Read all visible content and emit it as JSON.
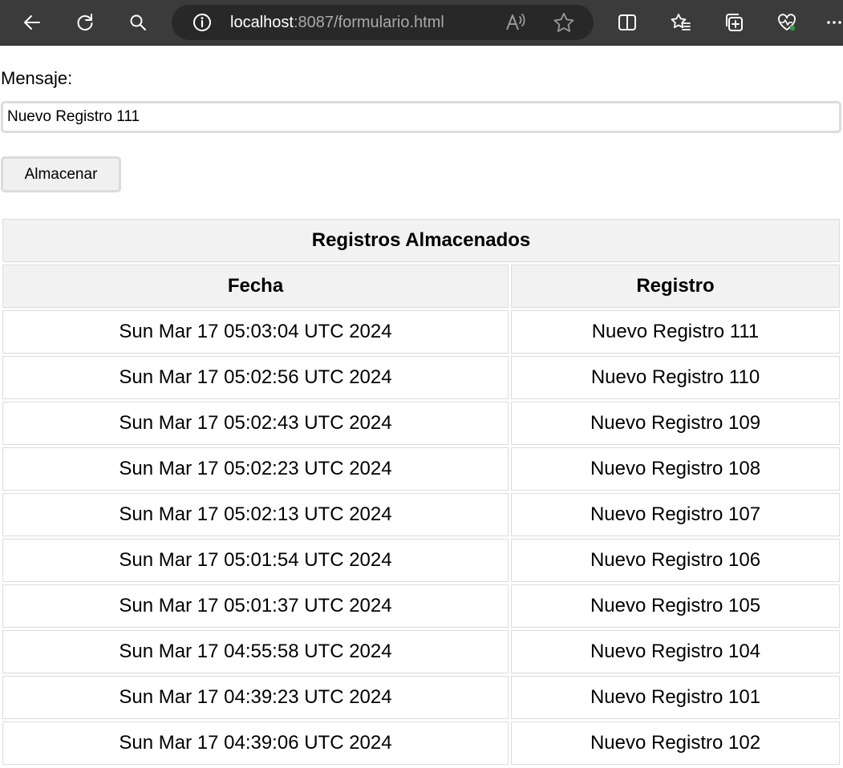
{
  "browser": {
    "url_host": "localhost",
    "url_rest": ":8087/formulario.html"
  },
  "form": {
    "label": "Mensaje:",
    "input_value": "Nuevo Registro 111",
    "submit_label": "Almacenar"
  },
  "table": {
    "caption": "Registros Almacenados",
    "headers": [
      "Fecha",
      "Registro"
    ],
    "rows": [
      [
        "Sun Mar 17 05:03:04 UTC 2024",
        "Nuevo Registro 111"
      ],
      [
        "Sun Mar 17 05:02:56 UTC 2024",
        "Nuevo Registro 110"
      ],
      [
        "Sun Mar 17 05:02:43 UTC 2024",
        "Nuevo Registro 109"
      ],
      [
        "Sun Mar 17 05:02:23 UTC 2024",
        "Nuevo Registro 108"
      ],
      [
        "Sun Mar 17 05:02:13 UTC 2024",
        "Nuevo Registro 107"
      ],
      [
        "Sun Mar 17 05:01:54 UTC 2024",
        "Nuevo Registro 106"
      ],
      [
        "Sun Mar 17 05:01:37 UTC 2024",
        "Nuevo Registro 105"
      ],
      [
        "Sun Mar 17 04:55:58 UTC 2024",
        "Nuevo Registro 104"
      ],
      [
        "Sun Mar 17 04:39:23 UTC 2024",
        "Nuevo Registro 101"
      ],
      [
        "Sun Mar 17 04:39:06 UTC 2024",
        "Nuevo Registro 102"
      ]
    ]
  }
}
